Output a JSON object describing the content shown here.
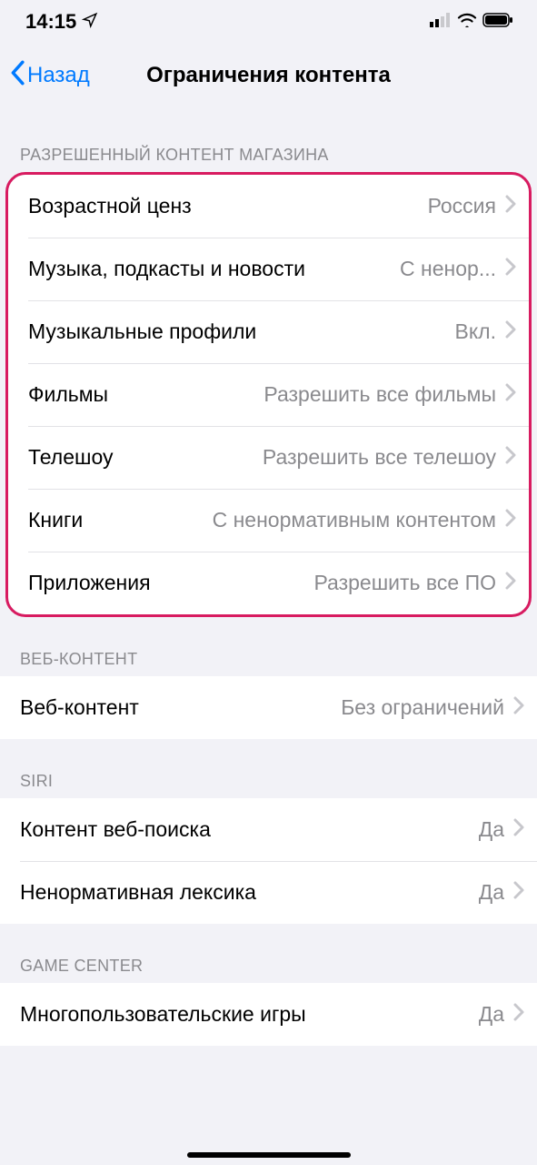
{
  "status": {
    "time": "14:15"
  },
  "nav": {
    "back": "Назад",
    "title": "Ограничения контента"
  },
  "sections": {
    "store": {
      "header": "РАЗРЕШЕННЫЙ КОНТЕНТ МАГАЗИНА",
      "rows": [
        {
          "label": "Возрастной ценз",
          "value": "Россия"
        },
        {
          "label": "Музыка, подкасты и новости",
          "value": "С ненор..."
        },
        {
          "label": "Музыкальные профили",
          "value": "Вкл."
        },
        {
          "label": "Фильмы",
          "value": "Разрешить все фильмы"
        },
        {
          "label": "Телешоу",
          "value": "Разрешить все телешоу"
        },
        {
          "label": "Книги",
          "value": "С ненормативным контентом"
        },
        {
          "label": "Приложения",
          "value": "Разрешить все ПО"
        }
      ]
    },
    "web": {
      "header": "ВЕБ-КОНТЕНТ",
      "rows": [
        {
          "label": "Веб-контент",
          "value": "Без ограничений"
        }
      ]
    },
    "siri": {
      "header": "SIRI",
      "rows": [
        {
          "label": "Контент веб-поиска",
          "value": "Да"
        },
        {
          "label": "Ненормативная лексика",
          "value": "Да"
        }
      ]
    },
    "gamecenter": {
      "header": "GAME CENTER",
      "rows": [
        {
          "label": "Многопользовательские игры",
          "value": "Да"
        }
      ]
    }
  }
}
